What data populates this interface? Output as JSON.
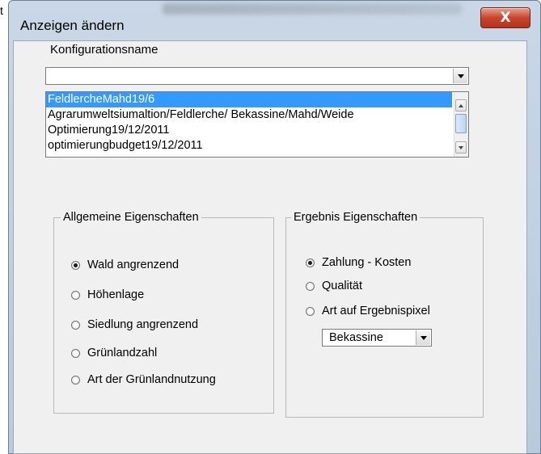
{
  "window": {
    "title": "Anzeigen ändern",
    "close_glyph": "X",
    "edge_glyph": "t"
  },
  "config": {
    "label": "Konfigurationsname",
    "combo_value": "",
    "list_items": [
      "FeldlercheMahd19/6",
      "Agrarumweltsiumaltion/Feldlerche/ Bekassine/Mahd/Weide",
      "Optimierung19/12/2011",
      "optimierungbudget19/12/2011"
    ],
    "selected_index": 0
  },
  "general_props": {
    "label": "Allgemeine Eigenschaften",
    "options": [
      "Wald angrenzend",
      "Höhenlage",
      "Siedlung angrenzend",
      "Grünlandzahl",
      "Art der Grünlandnutzung"
    ],
    "selected_index": 0
  },
  "result_props": {
    "label": "Ergebnis Eigenschaften",
    "options": [
      "Zahlung - Kosten",
      "Qualität",
      "Art auf Ergebnispixel"
    ],
    "selected_index": 0,
    "species_value": "Bekassine"
  },
  "colors": {
    "selection": "#3399ff",
    "close_button": "#c8452d"
  }
}
